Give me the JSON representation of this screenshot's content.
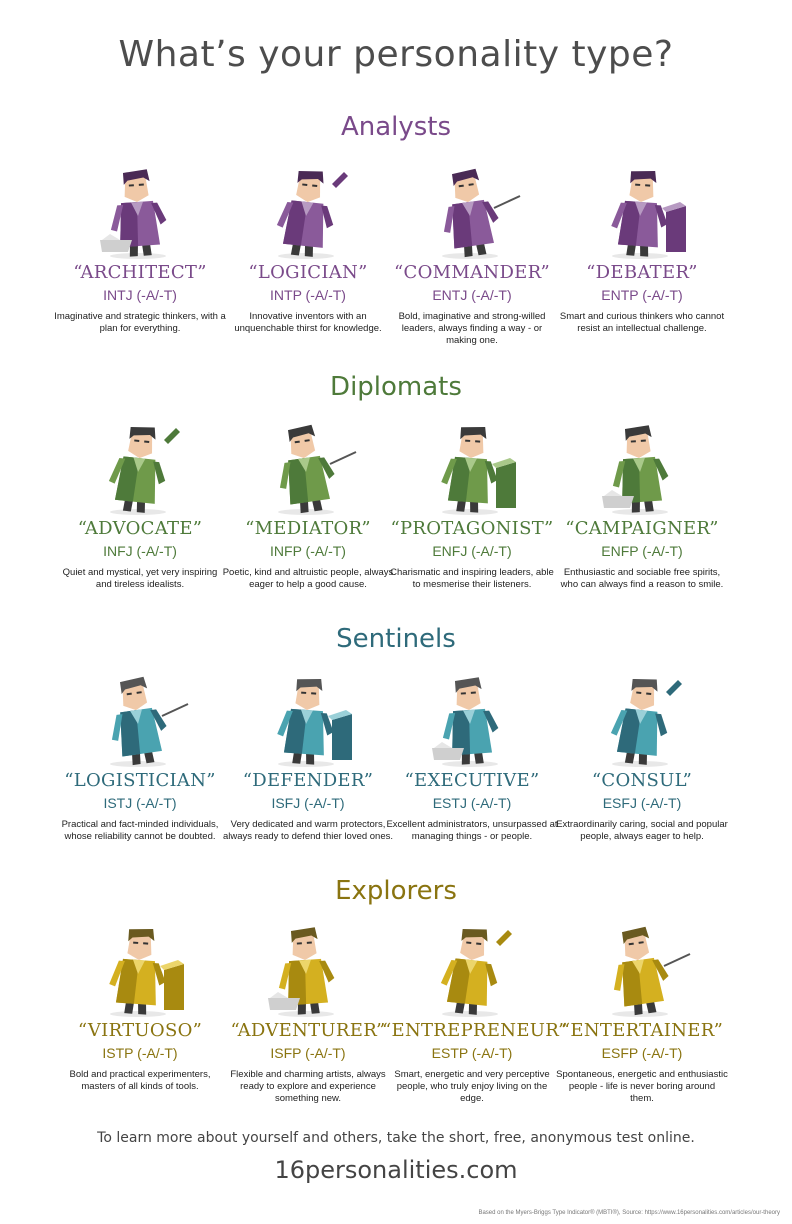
{
  "page": {
    "title": "What’s your personality type?"
  },
  "colors": {
    "analysts": "#7a4a8a",
    "diplomats": "#4e7a3a",
    "sentinels": "#2e6a7a",
    "explorers": "#8a7410"
  },
  "groups": [
    {
      "name": "Analysts",
      "types": [
        {
          "name": "“ARCHITECT”",
          "code": "INTJ (-A/-T)",
          "desc": "Imaginative and strategic thinkers, with a plan for everything."
        },
        {
          "name": "“LOGICIAN”",
          "code": "INTP (-A/-T)",
          "desc": "Innovative inventors with an unquenchable thirst for knowledge."
        },
        {
          "name": "“COMMANDER”",
          "code": "ENTJ (-A/-T)",
          "desc": "Bold, imaginative and strong-willed leaders, always finding a way - or making one."
        },
        {
          "name": "“DEBATER”",
          "code": "ENTP (-A/-T)",
          "desc": "Smart and curious thinkers who cannot resist an intellectual challenge."
        }
      ]
    },
    {
      "name": "Diplomats",
      "types": [
        {
          "name": "“ADVOCATE”",
          "code": "INFJ (-A/-T)",
          "desc": "Quiet and mystical, yet very inspiring and tireless idealists."
        },
        {
          "name": "“MEDIATOR”",
          "code": "INFP (-A/-T)",
          "desc": "Poetic, kind and altruistic people, always eager to help a good cause."
        },
        {
          "name": "“PROTAGONIST”",
          "code": "ENFJ (-A/-T)",
          "desc": "Charismatic and inspiring leaders, able to mesmerise their listeners."
        },
        {
          "name": "“CAMPAIGNER”",
          "code": "ENFP (-A/-T)",
          "desc": "Enthusiastic and sociable free spirits, who can always find a reason to smile."
        }
      ]
    },
    {
      "name": "Sentinels",
      "types": [
        {
          "name": "“LOGISTICIAN”",
          "code": "ISTJ (-A/-T)",
          "desc": "Practical and fact-minded individuals, whose reliability cannot be doubted."
        },
        {
          "name": "“DEFENDER”",
          "code": "ISFJ (-A/-T)",
          "desc": "Very dedicated and warm protectors, always ready to defend thier loved ones."
        },
        {
          "name": "“EXECUTIVE”",
          "code": "ESTJ (-A/-T)",
          "desc": "Excellent administrators, unsurpassed at managing things - or people."
        },
        {
          "name": "“CONSUL”",
          "code": "ESFJ (-A/-T)",
          "desc": "Extraordinarily caring, social and popular people, always eager to help."
        }
      ]
    },
    {
      "name": "Explorers",
      "types": [
        {
          "name": "“VIRTUOSO”",
          "code": "ISTP (-A/-T)",
          "desc": "Bold and practical experimenters, masters of all kinds of tools."
        },
        {
          "name": "“ADVENTURER”",
          "code": "ISFP (-A/-T)",
          "desc": "Flexible and charming artists, always ready to explore and experience something new."
        },
        {
          "name": "“ENTREPRENEUR”",
          "code": "ESTP (-A/-T)",
          "desc": "Smart, energetic and very perceptive people, who truly enjoy living on the edge."
        },
        {
          "name": "“ENTERTAINER”",
          "code": "ESFP (-A/-T)",
          "desc": "Spontaneous, energetic and enthusiastic people - life is never boring around them."
        }
      ]
    }
  ],
  "footer": {
    "cta": "To learn more about yourself and others, take the short, free, anonymous test online.",
    "site": "16personalities.com",
    "note": "Based on the Myers-Briggs Type Indicator® (MBTI®), Source: https://www.16personalities.com/articles/our-theory"
  }
}
